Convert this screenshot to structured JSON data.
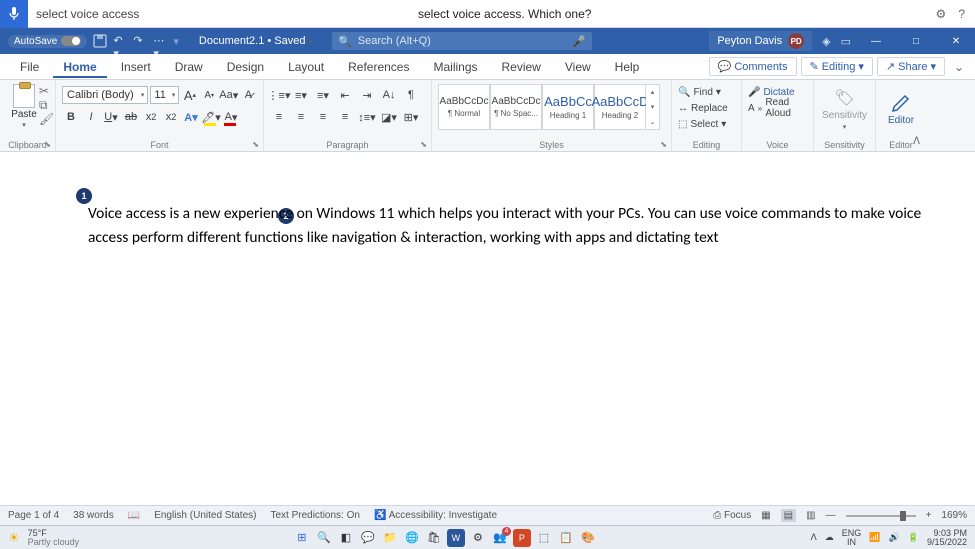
{
  "voice_access": {
    "input_text": "select voice access",
    "prompt": "select voice access. Which one?"
  },
  "titlebar": {
    "autosave": "AutoSave",
    "doc_name": "Document2.1 • Saved",
    "search_placeholder": "Search (Alt+Q)",
    "user_name": "Peyton Davis",
    "user_initials": "PD"
  },
  "tabs": {
    "items": [
      "File",
      "Home",
      "Insert",
      "Draw",
      "Design",
      "Layout",
      "References",
      "Mailings",
      "Review",
      "View",
      "Help"
    ],
    "active": "Home",
    "comments": "Comments",
    "editing": "Editing",
    "share": "Share"
  },
  "ribbon": {
    "clipboard": {
      "label": "Clipboard",
      "paste": "Paste"
    },
    "font": {
      "label": "Font",
      "name": "Calibri (Body)",
      "size": "11",
      "grow": "A",
      "shrink": "A",
      "case": "Aa"
    },
    "paragraph": {
      "label": "Paragraph"
    },
    "styles": {
      "label": "Styles",
      "items": [
        {
          "preview": "AaBbCcDc",
          "name": "¶ Normal",
          "big": false
        },
        {
          "preview": "AaBbCcDc",
          "name": "¶ No Spac...",
          "big": false
        },
        {
          "preview": "AaBbCc",
          "name": "Heading 1",
          "big": true
        },
        {
          "preview": "AaBbCcD",
          "name": "Heading 2",
          "big": true
        }
      ]
    },
    "editing": {
      "label": "Editing",
      "find": "Find",
      "replace": "Replace",
      "select": "Select"
    },
    "voice": {
      "label": "Voice",
      "dictate": "Dictate",
      "read": "Read Aloud"
    },
    "sensitivity": {
      "label": "Sensitivity",
      "btn": "Sensitivity"
    },
    "editor": {
      "label": "Editor",
      "btn": "Editor"
    }
  },
  "document": {
    "badges": {
      "b1": "1",
      "b2": "2"
    },
    "text": "Voice access is a new experience on Windows 11 which helps you interact with your PCs. You can use voice commands to make voice access perform different functions like navigation & interaction, working with apps and dictating text"
  },
  "statusbar": {
    "page": "Page 1 of 4",
    "words": "38 words",
    "lang": "English (United States)",
    "pred": "Text Predictions: On",
    "acc": "Accessibility: Investigate",
    "focus": "Focus",
    "zoom": "169%"
  },
  "taskbar": {
    "temp": "75°F",
    "weather": "Partly cloudy",
    "lang": "ENG",
    "region": "IN",
    "time": "9:03 PM",
    "date": "9/15/2022"
  }
}
